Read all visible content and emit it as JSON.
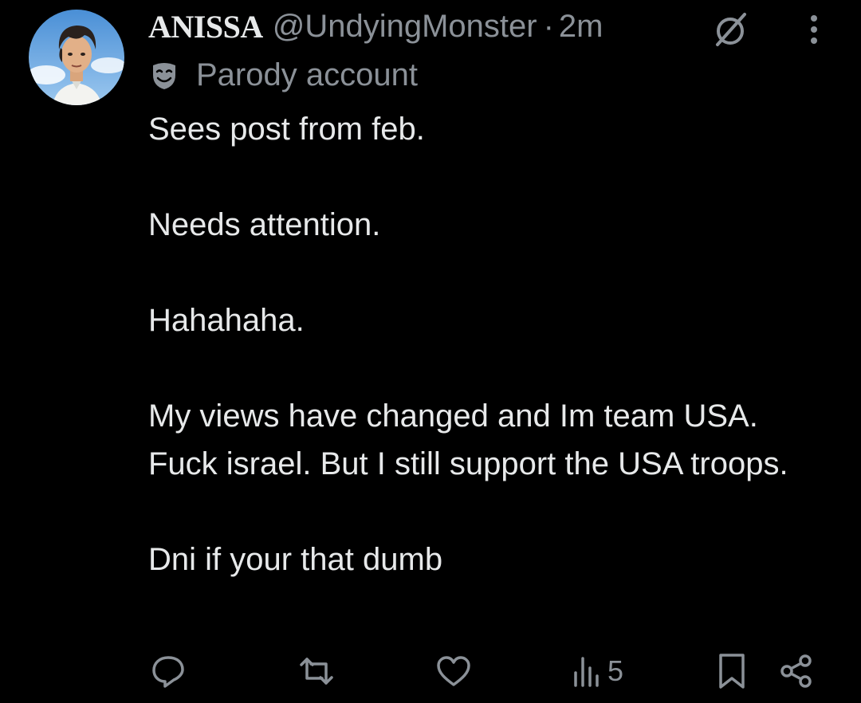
{
  "tweet": {
    "author": {
      "display_name": "ANISSA",
      "handle": "@UndyingMonster",
      "separator": "·",
      "timestamp": "2m",
      "badge_label": "Parody account",
      "badge_icon": "mask-icon"
    },
    "header_icons": [
      "slashed-circle-icon",
      "more-options-icon"
    ],
    "body": [
      "Sees post from feb.",
      "Needs attention.",
      "Hahahaha.",
      "My views have changed and Im team USA. Fuck israel. But I still support the USA troops.",
      "Dni if your that dumb"
    ],
    "actions": {
      "reply_icon": "reply-icon",
      "repost_icon": "repost-icon",
      "like_icon": "heart-icon",
      "views_icon": "views-icon",
      "views_count": "5",
      "bookmark_icon": "bookmark-icon",
      "share_icon": "share-icon"
    }
  },
  "colors": {
    "background": "#000000",
    "text_primary": "#e7e9ea",
    "text_secondary": "#8b9198"
  }
}
